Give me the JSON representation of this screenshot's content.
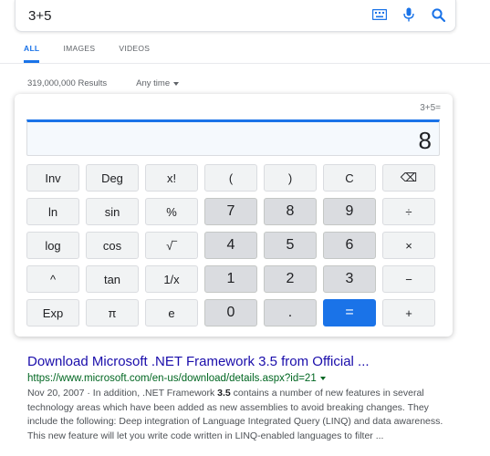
{
  "search": {
    "query": "3+5",
    "icons": [
      "keyboard-icon",
      "microphone-icon",
      "search-icon"
    ]
  },
  "tabs": [
    {
      "label": "ALL",
      "active": true
    },
    {
      "label": "IMAGES",
      "active": false
    },
    {
      "label": "VIDEOS",
      "active": false
    }
  ],
  "results_count": "319,000,000 Results",
  "time_filter": "Any time",
  "calculator": {
    "history": "3+5=",
    "display": "8",
    "keys": [
      [
        "Inv",
        "Deg",
        "x!",
        "(",
        ")",
        "C",
        "⌫"
      ],
      [
        "ln",
        "sin",
        "%",
        "7",
        "8",
        "9",
        "÷"
      ],
      [
        "log",
        "cos",
        "√‾",
        "4",
        "5",
        "6",
        "×"
      ],
      [
        "^",
        "tan",
        "1/x",
        "1",
        "2",
        "3",
        "−"
      ],
      [
        "Exp",
        "π",
        "e",
        "0",
        ".",
        "=",
        "+"
      ]
    ]
  },
  "result": {
    "title": "Download Microsoft .NET Framework 3.5 from Official ...",
    "url": "https://www.microsoft.com/en-us/download/details.aspx?id=21",
    "snippet_date": "Nov 20, 2007 · ",
    "snippet_part1": "In addition, .NET Framework ",
    "snippet_bold": "3.5",
    "snippet_part2": " contains a number of new features in several technology areas which have been added as new assemblies to avoid breaking changes. They include the following: Deep integration of Language Integrated Query (LINQ) and data awareness. This new feature will let you write code written in LINQ-enabled languages to filter ..."
  },
  "colors": {
    "accent": "#1a73e8",
    "link": "#1a0dab",
    "url": "#006621"
  }
}
